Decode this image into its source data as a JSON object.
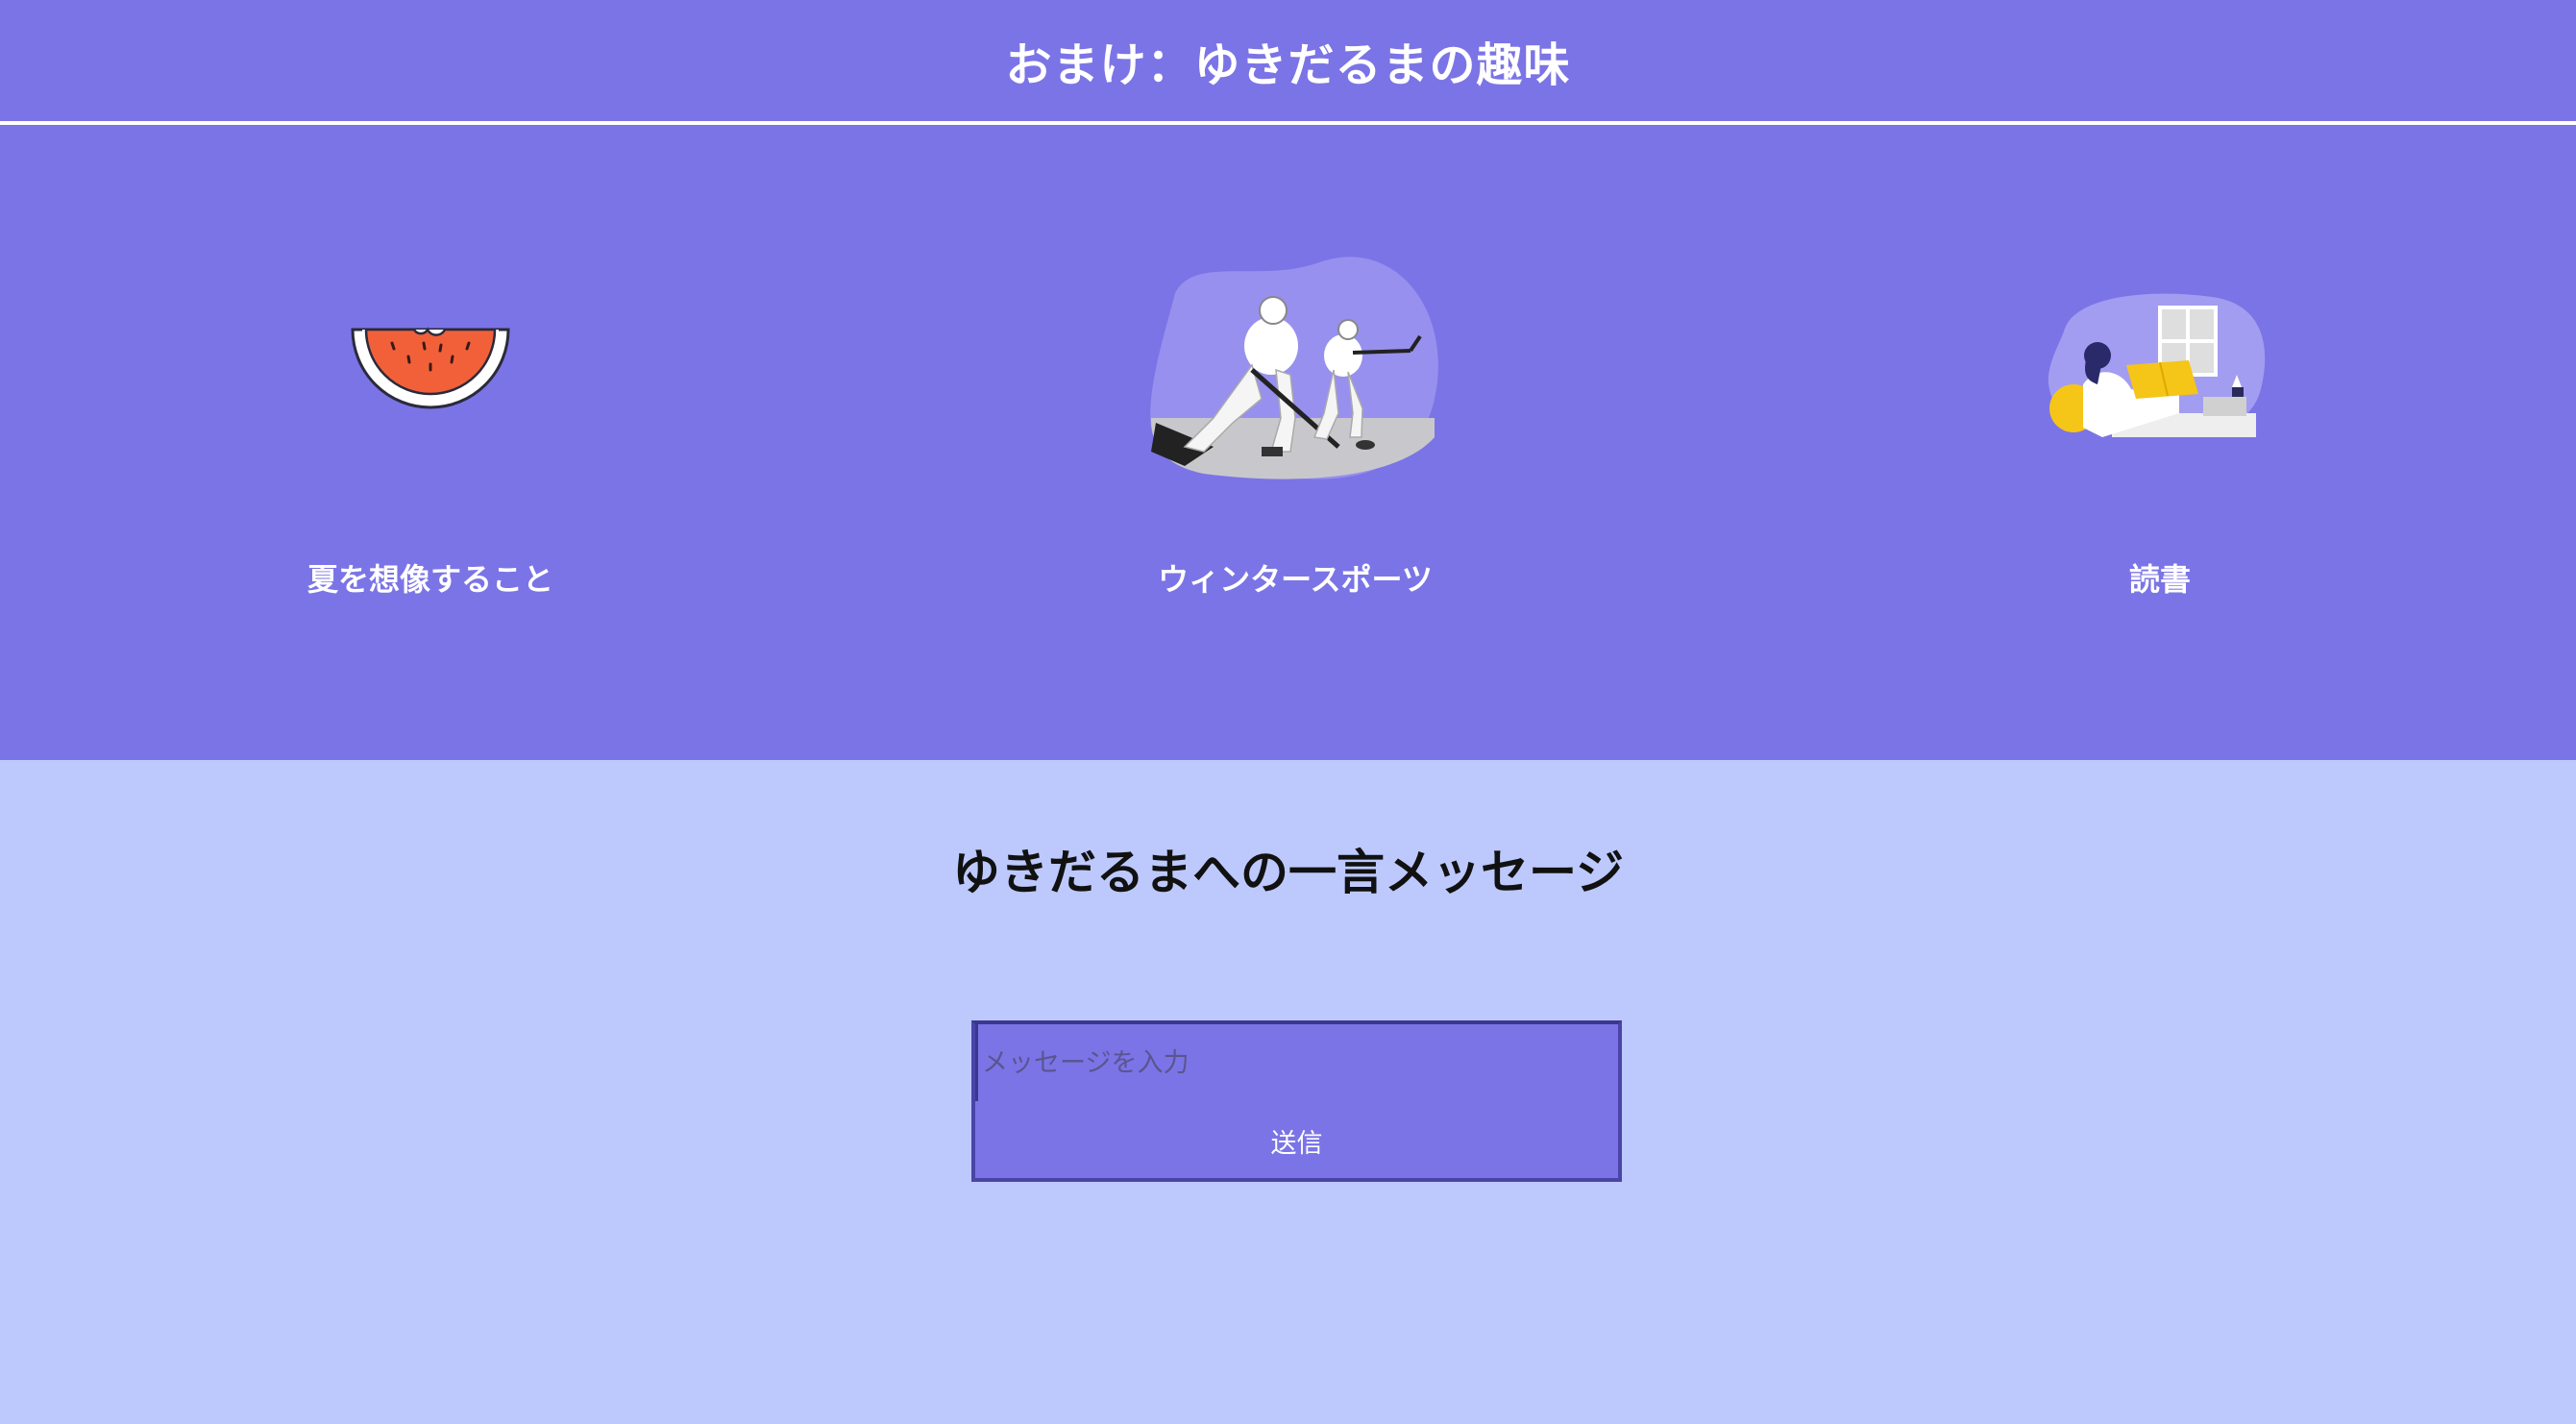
{
  "header": {
    "title": "おまけ：ゆきだるまの趣味"
  },
  "hobbies": [
    {
      "label": "夏を想像すること",
      "icon": "watermelon-icon"
    },
    {
      "label": "ウィンタースポーツ",
      "icon": "ice-hockey-players-illustration"
    },
    {
      "label": "読書",
      "icon": "woman-reading-illustration"
    }
  ],
  "message_section": {
    "title": "ゆきだるまへの一言メッセージ",
    "input_placeholder": "メッセージを入力",
    "input_value": "",
    "submit_label": "送信"
  },
  "colors": {
    "top_background": "#7b74e6",
    "bottom_background": "#bdc9fd",
    "text_light": "#ffffff"
  }
}
